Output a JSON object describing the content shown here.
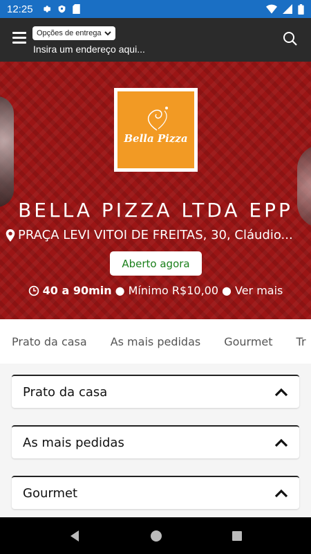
{
  "status_bar": {
    "time": "12:25"
  },
  "header": {
    "delivery_options_label": "Opções de entrega",
    "address_placeholder": "Insira um endereço aqui..."
  },
  "restaurant": {
    "name": "BELLA PIZZA LTDA EPP",
    "address": "PRAÇA LEVI VITOI DE FREITAS, 30, Cláudio...",
    "status": "Aberto agora",
    "delivery_time": "40 a 90min",
    "minimum": "Mínimo R$10,00",
    "see_more": "Ver mais",
    "logo_text": "Bella Pizza"
  },
  "tabs": [
    "Prato da casa",
    "As mais pedidas",
    "Gourmet",
    "Tr"
  ],
  "sections": [
    {
      "title": "Prato da casa"
    },
    {
      "title": "As mais pedidas"
    },
    {
      "title": "Gourmet"
    }
  ],
  "colors": {
    "status_bar": "#1a6fc4",
    "app_bar": "#2b2b2b",
    "hero": "#9b1515",
    "logo_bg": "#f29a24",
    "open_green": "#1a7f1a"
  }
}
